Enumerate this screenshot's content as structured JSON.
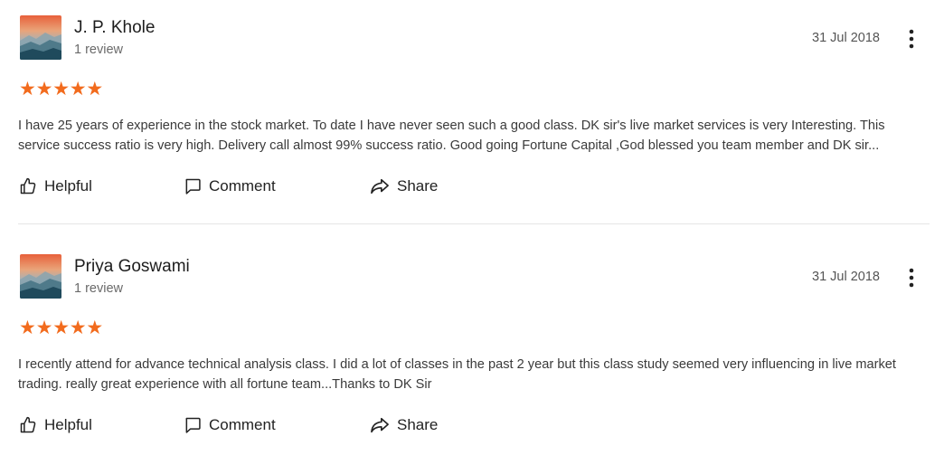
{
  "reviews": [
    {
      "author": "J. P. Khole",
      "review_count": "1 review",
      "date": "31 Jul 2018",
      "rating": 5,
      "stars": "★★★★★",
      "text": "I have 25 years of experience in the stock market. To date I have never seen such a good class. DK sir's live market services is very Interesting. This service success ratio is very high. Delivery call almost 99% success ratio. Good going Fortune Capital ,God blessed you team member and DK sir...",
      "actions": {
        "helpful": "Helpful",
        "comment": "Comment",
        "share": "Share"
      },
      "icons": {
        "avatar": "landscape-avatar-icon",
        "menu": "more-vertical-icon",
        "helpful": "thumbs-up-icon",
        "comment": "comment-icon",
        "share": "share-arrow-icon"
      }
    },
    {
      "author": "Priya Goswami",
      "review_count": "1 review",
      "date": "31 Jul 2018",
      "rating": 5,
      "stars": "★★★★★",
      "text": "I recently attend for advance technical analysis class. I did a lot of classes in the past 2 year but this class study seemed very influencing in live market trading. really great experience with all fortune team...Thanks to DK Sir",
      "actions": {
        "helpful": "Helpful",
        "comment": "Comment",
        "share": "Share"
      },
      "icons": {
        "avatar": "landscape-avatar-icon",
        "menu": "more-vertical-icon",
        "helpful": "thumbs-up-icon",
        "comment": "comment-icon",
        "share": "share-arrow-icon"
      }
    }
  ],
  "colors": {
    "star": "#f26b1d",
    "divider": "#e6e6e6",
    "text": "#3a3a3a"
  }
}
